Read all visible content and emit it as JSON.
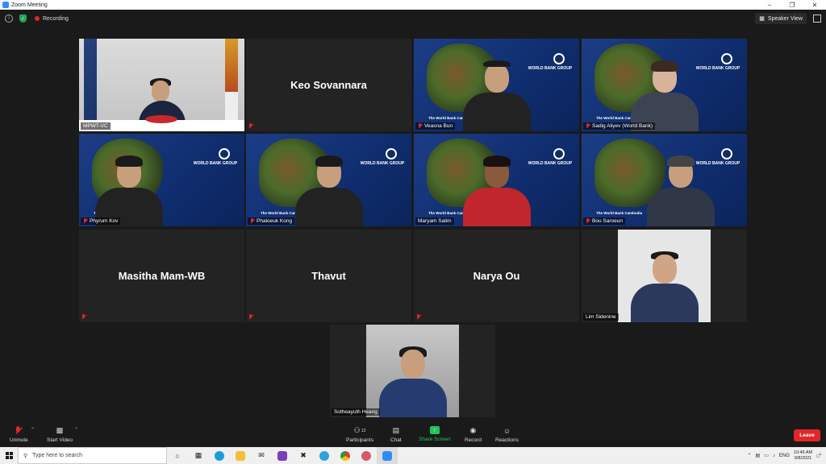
{
  "window": {
    "title": "Zoom Meeting"
  },
  "topbar": {
    "recording_label": "Recording",
    "speaker_view_label": "Speaker View"
  },
  "participants": [
    {
      "name": "MPWT-VC",
      "type": "video-office"
    },
    {
      "name": "Keo Sovannara",
      "type": "name-only"
    },
    {
      "name": "Veasna Bun",
      "type": "video-wb"
    },
    {
      "name": "Sadig Aliyev (World Bank)",
      "type": "video-wb"
    },
    {
      "name": "Phyrum Kov",
      "type": "video-wb"
    },
    {
      "name": "Phaloeuk Kong",
      "type": "video-wb"
    },
    {
      "name": "Maryam Salim",
      "type": "video-wb",
      "active": true
    },
    {
      "name": "Bou Saroeun",
      "type": "video-wb"
    },
    {
      "name": "Masitha Mam-WB",
      "type": "name-only"
    },
    {
      "name": "Thavut",
      "type": "name-only"
    },
    {
      "name": "Narya Ou",
      "type": "name-only"
    },
    {
      "name": "Lim Sidenine",
      "type": "photo"
    },
    {
      "name": "Sotheayuth Heang",
      "type": "photo"
    }
  ],
  "wb_background": {
    "group_text": "WORLD BANK GROUP",
    "bottom_text": "The World Bank Cambodia"
  },
  "toolbar": {
    "unmute_label": "Unmute",
    "start_video_label": "Start Video",
    "participants_label": "Participants",
    "participants_count": "13",
    "chat_label": "Chat",
    "share_screen_label": "Share Screen",
    "record_label": "Record",
    "reactions_label": "Reactions",
    "leave_label": "Leave"
  },
  "taskbar": {
    "search_placeholder": "Type here to search",
    "language": "ENG",
    "time": "10:46 AM",
    "date": "9/8/2021",
    "notification_count": "6"
  },
  "colors": {
    "active_border": "#e6e84a",
    "leave": "#e02828",
    "share": "#23c35a",
    "accent": "#2d8cff"
  }
}
